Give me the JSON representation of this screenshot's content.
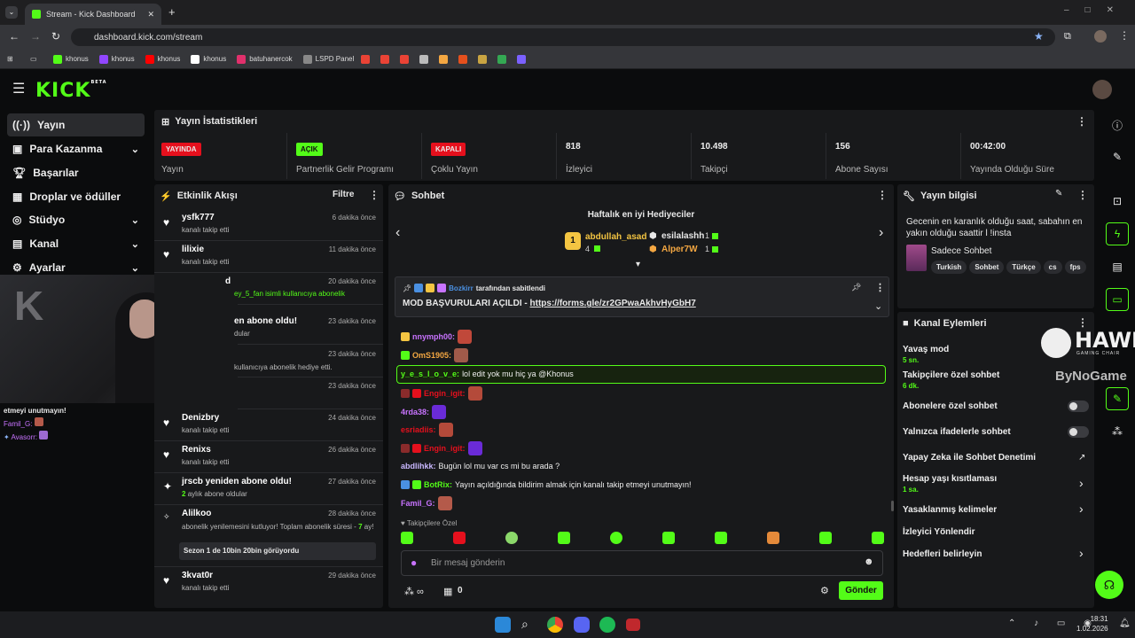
{
  "browser": {
    "tab_title": "Stream - Kick Dashboard",
    "url": "dashboard.kick.com/stream",
    "bookmarks": [
      {
        "label": "khonus",
        "color": "#53fc18"
      },
      {
        "label": "khonus",
        "color": "#9146ff"
      },
      {
        "label": "khonus",
        "color": "#ff0000"
      },
      {
        "label": "khonus",
        "color": "#ffffff"
      },
      {
        "label": "batuhanercok",
        "color": "#e1306c"
      },
      {
        "label": "LSPD Panel",
        "color": "#888888"
      }
    ]
  },
  "header": {
    "logo": "KICK",
    "logo_sup": "BETA"
  },
  "nav": {
    "items": [
      {
        "label": "Yayın",
        "icon": "broadcast-icon",
        "active": true
      },
      {
        "label": "Para Kazanma",
        "icon": "money-icon",
        "chev": "⌄"
      },
      {
        "label": "Başarılar",
        "icon": "trophy-icon"
      },
      {
        "label": "Droplar ve ödüller",
        "icon": "gift-icon"
      },
      {
        "label": "Stüdyo",
        "icon": "studio-icon",
        "chev": "⌄"
      },
      {
        "label": "Kanal",
        "icon": "channel-icon",
        "chev": "⌄"
      },
      {
        "label": "Ayarlar",
        "icon": "gear-icon",
        "chev": "⌄"
      }
    ]
  },
  "stats": {
    "title": "Yayın İstatistikleri",
    "items": [
      {
        "badge": "YAYINDA",
        "badge_color": "#e5101d",
        "label": "Yayın"
      },
      {
        "badge": "AÇIK",
        "badge_color": "#53fc18",
        "label": "Partnerlik Gelir Programı"
      },
      {
        "badge": "KAPALI",
        "badge_color": "#e5101d",
        "label": "Çoklu Yayın"
      },
      {
        "value": "818",
        "label": "İzleyici"
      },
      {
        "value": "10.498",
        "label": "Takipçi"
      },
      {
        "value": "156",
        "label": "Abone Sayısı"
      },
      {
        "value": "00:42:00",
        "label": "Yayında Olduğu Süre"
      }
    ]
  },
  "activity": {
    "title": "Etkinlik Akışı",
    "filter": "Filtre",
    "items": [
      {
        "name": "ysfk777",
        "sub": "kanalı takip etti",
        "time": "6 dakika önce"
      },
      {
        "name": "lilixie",
        "sub": "kanalı takip etti",
        "time": "11 dakika önce"
      },
      {
        "name": "d",
        "sub": "ey_5_fan isimli kullanıcıya abonelik",
        "time": "20 dakika önce"
      },
      {
        "name": "en abone oldu!",
        "sub": "dular",
        "time": "23 dakika önce"
      },
      {
        "name": "",
        "sub": "kullanıcıya abonelik hediye etti.",
        "time": "23 dakika önce"
      },
      {
        "name": "",
        "sub": "",
        "time": "23 dakika önce"
      },
      {
        "name": "Denizbry",
        "sub": "kanalı takip etti",
        "time": "24 dakika önce"
      },
      {
        "name": "Renixs",
        "sub": "kanalı takip etti",
        "time": "26 dakika önce"
      },
      {
        "name": "jrscb yeniden abone oldu!",
        "sub": "aylık abone oldular",
        "sub_num": "2",
        "time": "27 dakika önce"
      },
      {
        "name": "Alilkoo",
        "sub": "abonelik yenilemesini kutluyor! Toplam abonelik süresi -",
        "sub_num": "7",
        "sub2": "ay!",
        "msg": "Sezon 1 de 10bin 20bin görüyordu",
        "time": "28 dakika önce"
      },
      {
        "name": "3kvat0r",
        "sub": "kanalı takip etti",
        "time": "29 dakika önce"
      }
    ]
  },
  "overlay_chat": [
    {
      "text": "etmeyi unutmayın!"
    },
    {
      "user": "Famil_G:",
      "color": "#c873ff"
    },
    {
      "user": "Avasorr:",
      "color": "#c873ff"
    }
  ],
  "chat": {
    "title": "Sohbet",
    "top_gifters_title": "Haftalık en iyi Hediyeciler",
    "gifters": [
      {
        "name": "abdullah_asad",
        "count": "4",
        "color": "#f4c542"
      },
      {
        "name": "esilalashh",
        "count": "1",
        "color": "#eeeeee"
      },
      {
        "name": "Alper7W",
        "count": "1",
        "color": "#f4a742"
      }
    ],
    "pinned_by": "Bozkirr",
    "pinned_suffix": "tarafından sabitlendi",
    "pinned_msg": "MOD BAŞVURULARI AÇILDI - ",
    "pinned_link": "https://forms.gle/zr2GPwaAkhvHyGbH7",
    "messages": [
      {
        "user": "nnymph00:",
        "color": "#c873ff"
      },
      {
        "user": "OmS1905:",
        "color": "#f4a742"
      },
      {
        "user": "y_e_s_l_o_v_e:",
        "color": "#53fc18",
        "text": "lol edit yok mu hiç ya @Khonus",
        "highlight": true
      },
      {
        "user": "Engin_igit:",
        "color": "#e5101d"
      },
      {
        "user": "4rda38:",
        "color": "#c873ff"
      },
      {
        "user": "esriadiis:",
        "color": "#e5101d"
      },
      {
        "user": "Engin_igit:",
        "color": "#e5101d"
      },
      {
        "user": "abdlihkk:",
        "color": "#c9b8ff",
        "text": "Bugün lol mu var cs mi bu arada ?"
      },
      {
        "user": "BotRix:",
        "color": "#53fc18",
        "text": "Yayın açıldığında bildirim almak için kanalı takip etmeyi unutmayın!"
      },
      {
        "user": "Famil_G:",
        "color": "#c873ff"
      }
    ],
    "emotes_label": "Takipçilere Özel",
    "input_placeholder": "Bir mesaj gönderin",
    "points": "0",
    "send": "Gönder"
  },
  "stream_info": {
    "title": "Yayın bilgisi",
    "stream_title": "Gecenin en karanlık olduğu saat, sabahın en yakın olduğu saattir l !insta",
    "category": "Sadece Sohbet",
    "tags": [
      "Turkish",
      "Sohbet",
      "Türkçe",
      "cs",
      "fps"
    ]
  },
  "channel_actions": {
    "title": "Kanal Eylemleri",
    "items": [
      {
        "label": "Yavaş mod",
        "sub": "5 sn."
      },
      {
        "label": "Takipçilere özel sohbet",
        "sub": "6 dk."
      },
      {
        "label": "Abonelere özel sohbet",
        "toggle": true
      },
      {
        "label": "Yalnızca ifadelerle sohbet",
        "toggle": true
      },
      {
        "label": "Yapay Zeka ile Sohbet Denetimi"
      },
      {
        "label": "Hesap yaşı kısıtlaması",
        "sub": "1 sa.",
        "chevron": true
      },
      {
        "label": "Yasaklanmış kelimeler",
        "chevron": true
      },
      {
        "label": "İzleyici Yönlendir"
      },
      {
        "label": "Hedefleri belirleyin",
        "chevron": true
      }
    ]
  },
  "watermark": {
    "brand": "HAWK",
    "sub": "GAMING CHAIR",
    "partner": "ByNoGame"
  },
  "taskbar": {
    "time": "18:31",
    "date": "1.02.2026"
  },
  "colors": {
    "accent": "#53fc18",
    "bg": "#0b0c0d",
    "panel": "#18191b"
  }
}
